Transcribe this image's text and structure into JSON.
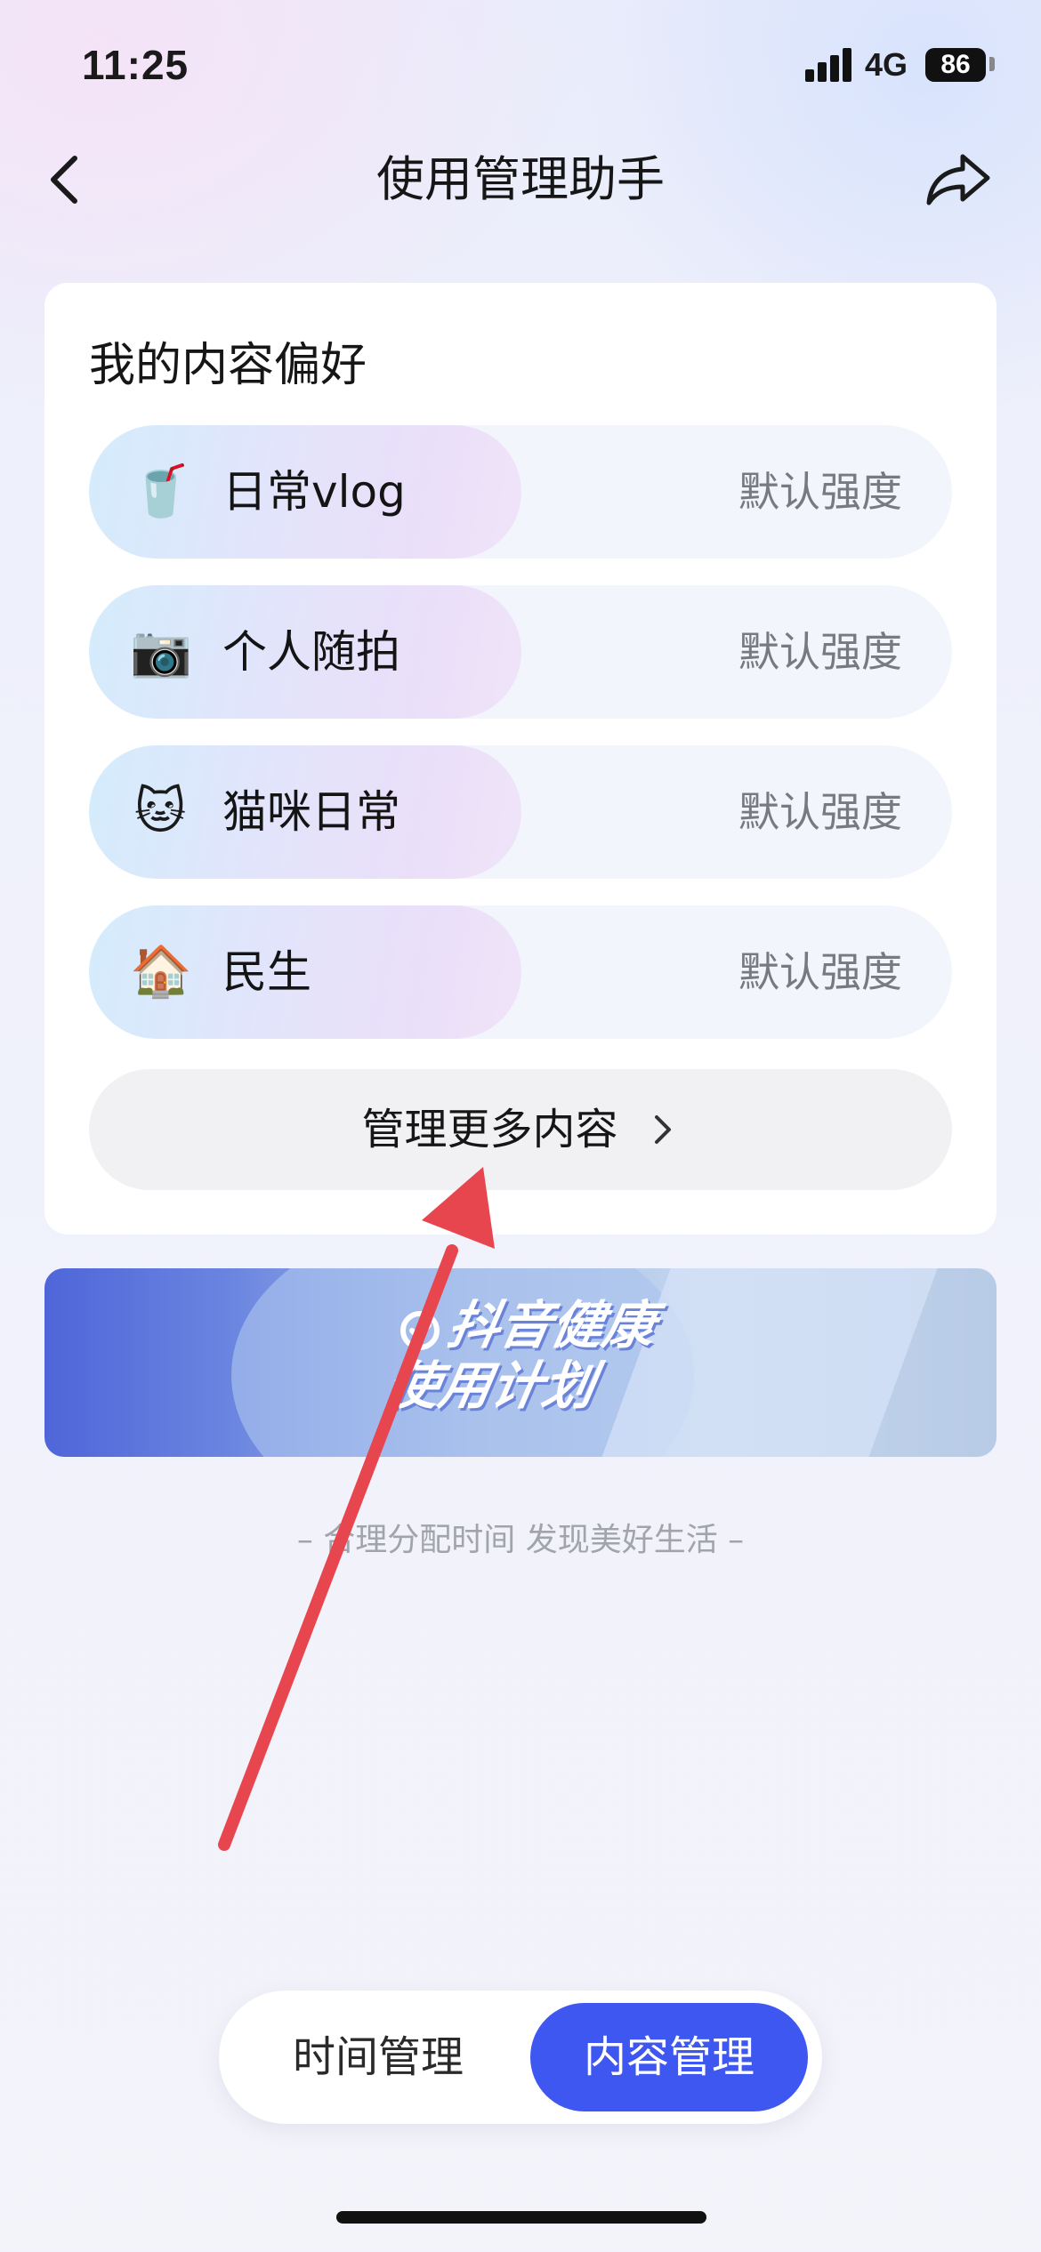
{
  "status_bar": {
    "time": "11:25",
    "network": "4G",
    "battery": "86"
  },
  "header": {
    "title": "使用管理助手",
    "back_icon": "chevron-left-icon",
    "share_icon": "share-arrow-icon"
  },
  "preferences": {
    "title": "我的内容偏好",
    "items": [
      {
        "label": "日常vlog",
        "strength": "默认强度",
        "emoji": "🥤"
      },
      {
        "label": "个人随拍",
        "strength": "默认强度",
        "emoji": "📷"
      },
      {
        "label": "猫咪日常",
        "strength": "默认强度",
        "emoji": "🐱"
      },
      {
        "label": "民生",
        "strength": "默认强度",
        "emoji": "🏠"
      }
    ],
    "more_label": "管理更多内容"
  },
  "banner": {
    "line1": "抖音健康",
    "line2": "使用计划"
  },
  "slogan": "– 合理分配时间 发现美好生活 –",
  "tabs": {
    "time": "时间管理",
    "content": "内容管理"
  },
  "colors": {
    "accent": "#3e57f0",
    "annotation_arrow": "#e8464f"
  }
}
